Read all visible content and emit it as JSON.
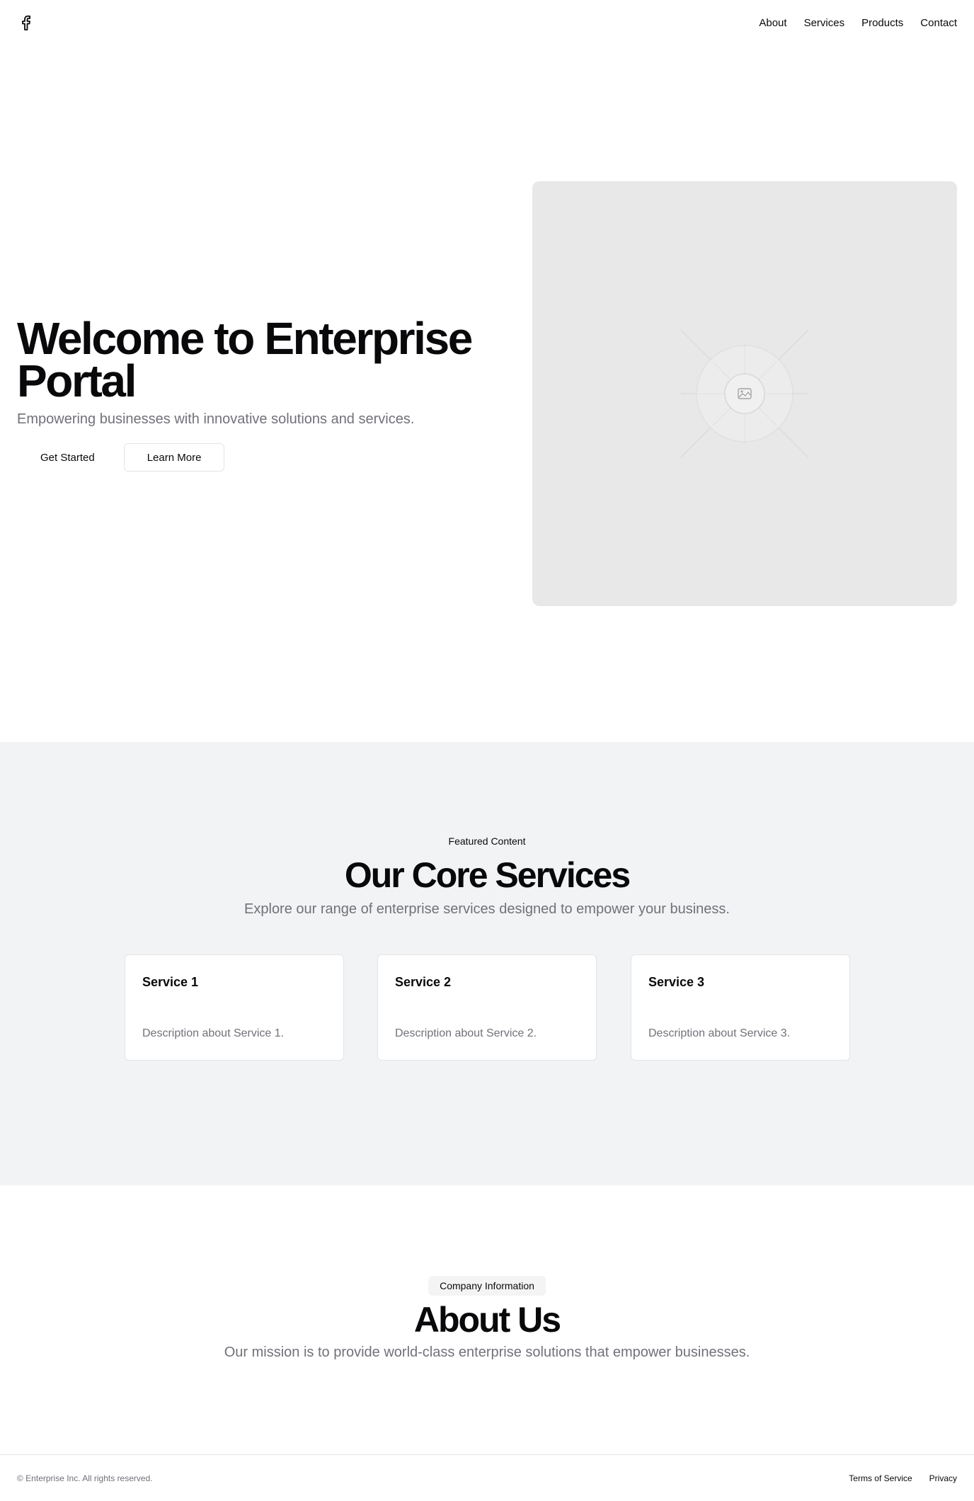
{
  "header": {
    "logo_icon": "facebook-icon",
    "nav": [
      "About",
      "Services",
      "Products",
      "Contact"
    ]
  },
  "hero": {
    "title": "Welcome to Enterprise Portal",
    "subtitle": "Empowering businesses with innovative solutions and services.",
    "primary_button": "Get Started",
    "secondary_button": "Learn More",
    "image_icon": "image-placeholder-icon"
  },
  "services": {
    "eyebrow": "Featured Content",
    "title": "Our Core Services",
    "subtitle": "Explore our range of enterprise services designed to empower your business.",
    "cards": [
      {
        "title": "Service 1",
        "description": "Description about Service 1."
      },
      {
        "title": "Service 2",
        "description": "Description about Service 2."
      },
      {
        "title": "Service 3",
        "description": "Description about Service 3."
      }
    ]
  },
  "about": {
    "badge": "Company Information",
    "title": "About Us",
    "subtitle": "Our mission is to provide world-class enterprise solutions that empower businesses."
  },
  "footer": {
    "copyright": "© Enterprise Inc. All rights reserved.",
    "links": [
      "Terms of Service",
      "Privacy"
    ]
  },
  "colors": {
    "text": "#09090b",
    "muted": "#71717a",
    "section_bg": "#f2f3f4",
    "placeholder_bg": "#e8e8e8",
    "border": "#e4e4e7"
  }
}
